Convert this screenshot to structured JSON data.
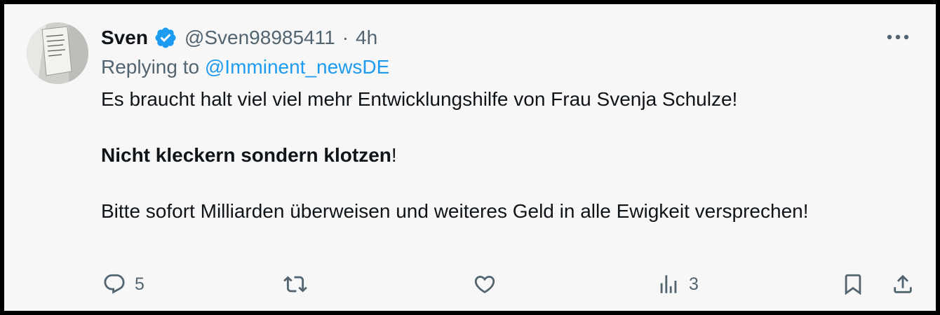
{
  "tweet": {
    "author_name": "Sven",
    "handle": "@Sven98985411",
    "separator": "·",
    "time": "4h",
    "replying_prefix": "Replying to",
    "replying_to": "@Imminent_newsDE",
    "paragraph1": "Es braucht halt viel viel mehr Entwicklungshilfe von Frau Svenja Schulze!",
    "paragraph2_bold": "Nicht kleckern sondern klotzen",
    "paragraph2_tail": "!",
    "paragraph3": "Bitte sofort Milliarden überweisen und weiteres Geld in alle Ewigkeit versprechen!"
  },
  "actions": {
    "reply_count": "5",
    "views_count": "3"
  },
  "colors": {
    "accent": "#1d9bf0",
    "muted": "#536471",
    "text": "#0f1419",
    "background": "#f7f7f7"
  },
  "icons": [
    "verified-badge-icon",
    "more-icon",
    "reply-icon",
    "retweet-icon",
    "like-icon",
    "views-icon",
    "bookmark-icon",
    "share-icon"
  ]
}
